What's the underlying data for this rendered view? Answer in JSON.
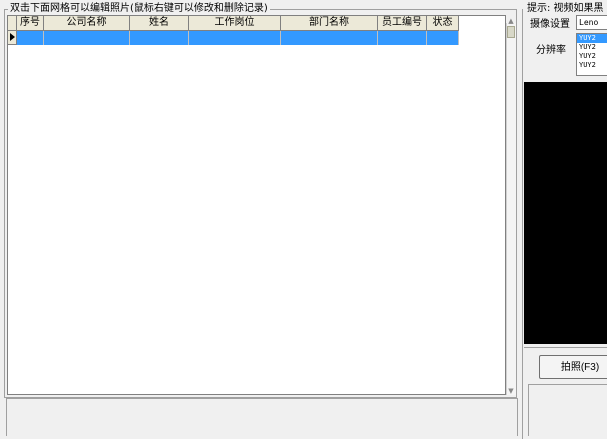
{
  "grid_panel": {
    "caption": "双击下面网格可以编辑照片(鼠标右键可以修改和删除记录)",
    "columns": [
      {
        "label": "序号"
      },
      {
        "label": "公司名称"
      },
      {
        "label": "姓名"
      },
      {
        "label": "工作岗位"
      },
      {
        "label": "部门名称"
      },
      {
        "label": "员工编号"
      },
      {
        "label": "状态"
      }
    ]
  },
  "camera_panel": {
    "hint": "提示: 视频如果黑",
    "camera_label": "摄像设置",
    "camera_value": "Leno",
    "resolution_label": "分辨率",
    "resolution_options": [
      "YUY2",
      "YUY2",
      "YUY2",
      "YUY2"
    ],
    "selected_resolution_index": 0,
    "capture_button": "拍照(F3)"
  }
}
